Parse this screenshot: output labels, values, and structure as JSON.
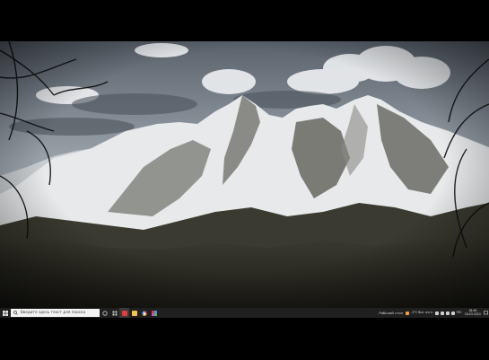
{
  "desktop": {
    "wallpaper": "snowy-mountain-landscape"
  },
  "taskbar": {
    "search_placeholder": "Введите здесь текст для поиска",
    "weather_widget": "Рабочий стол",
    "temperature": "-3°C Вкл. взгл.",
    "language": "РУС",
    "time": "18:49",
    "date": "16.03.2022",
    "pinned_apps": [
      {
        "name": "task-view",
        "color": "#d0d0d0"
      },
      {
        "name": "widgets",
        "color": "#d0d0d0"
      },
      {
        "name": "app-red",
        "color": "#e23b3b"
      },
      {
        "name": "file-explorer",
        "color": "#f3c24a"
      },
      {
        "name": "chrome",
        "color": "#4a8df0"
      },
      {
        "name": "app-multi",
        "color": "#d14ad0"
      }
    ],
    "accent": "#0078d7"
  }
}
